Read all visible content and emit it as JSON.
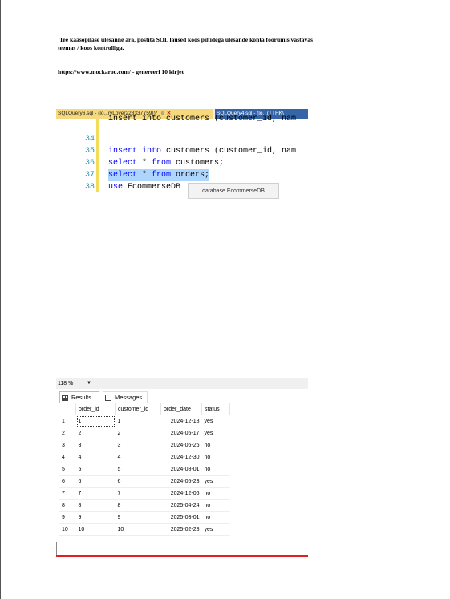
{
  "document": {
    "paragraph1_line1": "Tee kaasõpilase ülesanne ära, postita  SQL laused  koos piltidega ülesande kohta foorumis vastavas",
    "paragraph1_line2": "teemas / koos kontrolliga.",
    "paragraph2": "https://www.mockaroo.com/ - genereeri 10 kirjet"
  },
  "editor": {
    "tab_active": "SQLQuery6.sql - (lo...ryLover228337 (59))*",
    "tab_other": "SQLQuery4.sql - (lo...(TTHK\\",
    "partial_line": "insert into customers (customer_id, nam",
    "lines": [
      {
        "num": "34",
        "kw1": "insert into",
        "rest": " customers (customer_id, nam"
      },
      {
        "num": "35",
        "kw1": "select",
        "star": " * ",
        "kw2": "from",
        "rest": " customers;"
      },
      {
        "num": "36",
        "kw1": "select",
        "star": " * ",
        "kw2": "from",
        "rest": " orders;"
      },
      {
        "num": "37",
        "kw1": "use",
        "rest": " EcommerseDB"
      },
      {
        "num": "38"
      }
    ],
    "tooltip": "database EcommerseDB",
    "zoom": "118 %"
  },
  "results": {
    "tab_results": "Results",
    "tab_messages": "Messages",
    "columns": [
      "order_id",
      "customer_id",
      "order_date",
      "status"
    ],
    "rows": [
      [
        "1",
        "1",
        "1",
        "2024-12-18",
        "yes"
      ],
      [
        "2",
        "2",
        "2",
        "2024-05-17",
        "yes"
      ],
      [
        "3",
        "3",
        "3",
        "2024-06-26",
        "no"
      ],
      [
        "4",
        "4",
        "4",
        "2024-12-30",
        "no"
      ],
      [
        "5",
        "5",
        "5",
        "2024-08-01",
        "no"
      ],
      [
        "6",
        "6",
        "6",
        "2024-05-23",
        "yes"
      ],
      [
        "7",
        "7",
        "7",
        "2024-12-06",
        "no"
      ],
      [
        "8",
        "8",
        "8",
        "2025-04-24",
        "no"
      ],
      [
        "9",
        "9",
        "9",
        "2025-03-01",
        "no"
      ],
      [
        "10",
        "10",
        "10",
        "2025-02-28",
        "yes"
      ]
    ]
  },
  "colors": {
    "active_tab": "#f5d97c",
    "other_tab": "#3565a8",
    "keyword": "#0000ff",
    "line_number": "#2b91af",
    "selection": "#add6ff",
    "red_line": "#e02020"
  },
  "icons": {
    "close": "close-icon",
    "pin": "pin-icon",
    "results": "grid-icon",
    "messages": "messages-icon"
  }
}
